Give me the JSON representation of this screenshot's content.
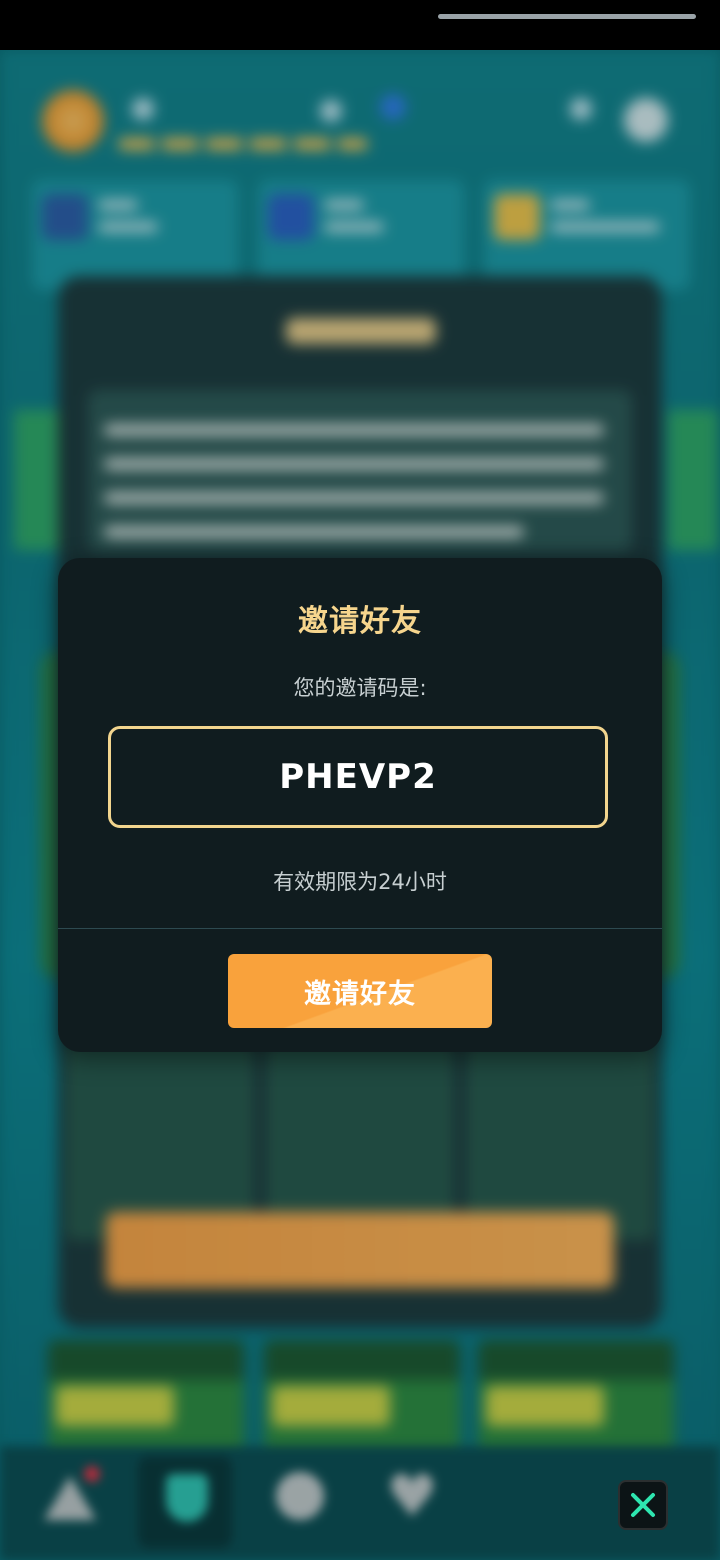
{
  "dialog": {
    "title": "邀请好友",
    "code_label": "您的邀请码是:",
    "invite_code": "PHEVP2",
    "validity_note": "有效期限为24小时",
    "invite_button_label": "邀请好友"
  },
  "close_button": {
    "icon": "close-icon"
  },
  "bottom_nav": {
    "items": [
      {
        "icon": "warning-triangle-icon",
        "has_badge": true
      },
      {
        "icon": "shield-icon",
        "active": true
      },
      {
        "icon": "compass-icon"
      },
      {
        "icon": "heart-icon"
      }
    ]
  },
  "colors": {
    "dialog_bg": "#101c1f",
    "title_gold": "#f6d58d",
    "code_border": "#f2d58e",
    "button_orange": "#f9a23c",
    "close_accent": "#2ee6b0"
  }
}
